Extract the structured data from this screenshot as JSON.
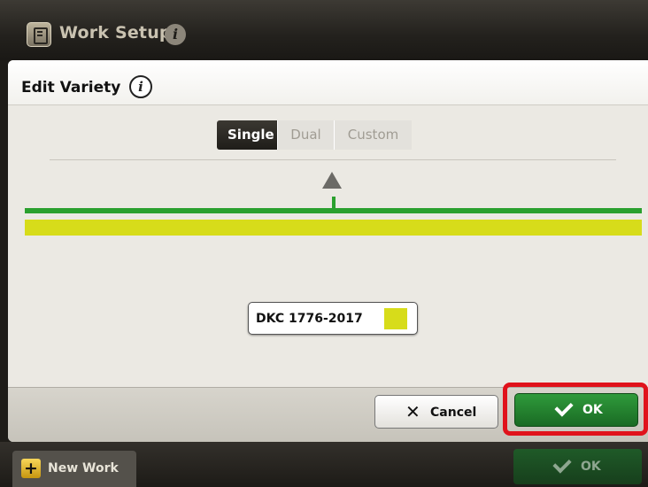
{
  "topbar": {
    "title": "Work Setup",
    "info_icon": "info-icon",
    "app_icon": "notebook-icon"
  },
  "dialog": {
    "title": "Edit Variety",
    "info_icon": "info-icon",
    "modes": [
      {
        "label": "Single",
        "selected": true
      },
      {
        "label": "Dual",
        "selected": false
      },
      {
        "label": "Custom",
        "selected": false
      }
    ],
    "variety": {
      "name": "DKC 1776-2017",
      "color": "#d7dc1a"
    },
    "guidance_line_color": "#2aa02e",
    "buttons": {
      "cancel": "Cancel",
      "ok": "OK"
    }
  },
  "bottombar": {
    "new_work_label": "New Work",
    "ok_label": "OK"
  },
  "colors": {
    "accent_green": "#2aa02e",
    "highlight_red": "#e0121b",
    "variety_yellow": "#d7dc1a"
  }
}
